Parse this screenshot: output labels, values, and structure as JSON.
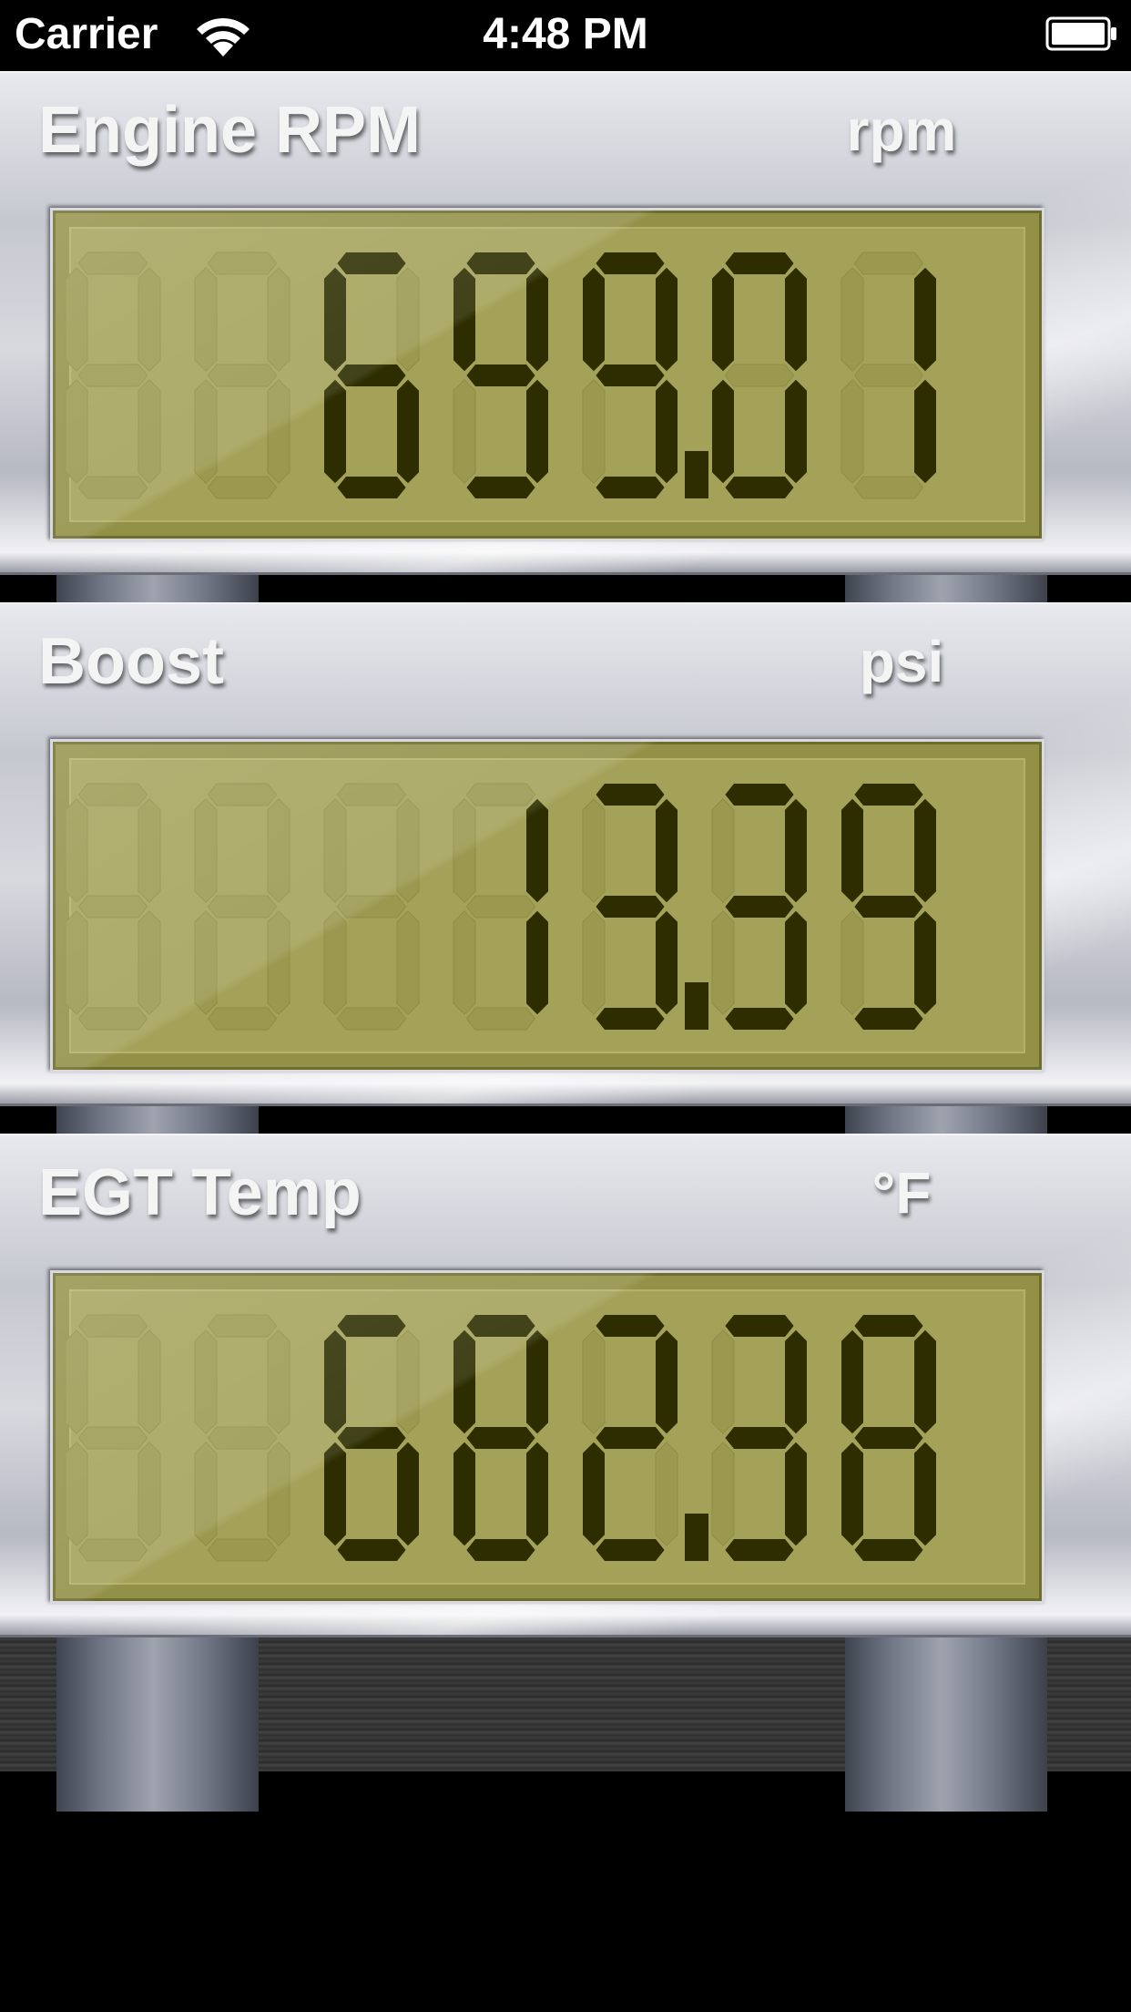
{
  "status_bar": {
    "carrier": "Carrier",
    "time": "4:48 PM",
    "icons": [
      "wifi-icon",
      "battery-icon"
    ]
  },
  "gauges": [
    {
      "label": "Engine RPM",
      "unit": "rpm",
      "value": "699.01"
    },
    {
      "label": "Boost",
      "unit": "psi",
      "value": "13.39"
    },
    {
      "label": "EGT Temp",
      "unit": "°F",
      "value": "682.38"
    }
  ],
  "colors": {
    "lcd_background": "#a4a259",
    "segment_on": "#2d2d00",
    "segment_off": "#9b9950",
    "panel_metal": "#c6c8d0"
  }
}
